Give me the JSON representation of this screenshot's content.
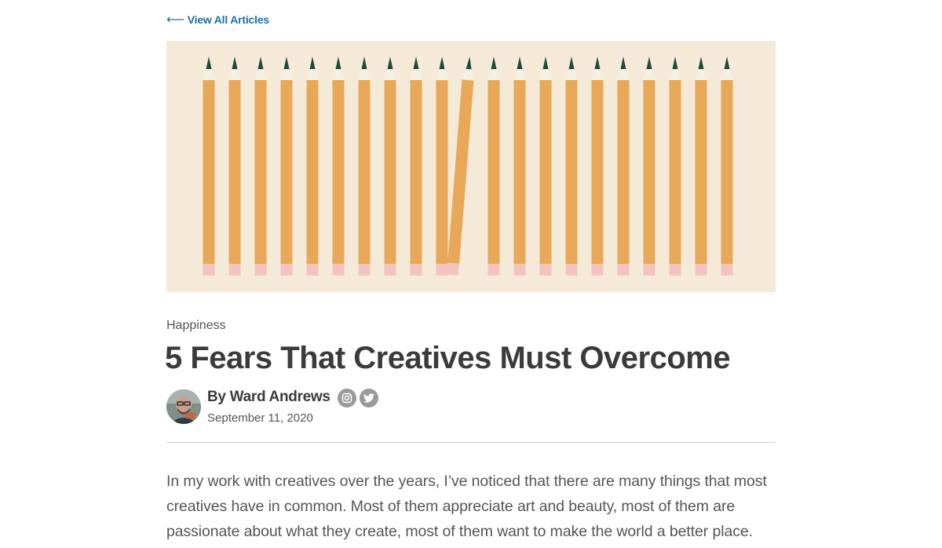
{
  "nav": {
    "back_arrow": "⟵",
    "back_label": "View All Articles"
  },
  "hero": {
    "illustration": "row of pencils with one tilted pencil",
    "colors": {
      "background": "#f5ead8",
      "pencil_body": "#e8a857",
      "pencil_wood": "#f3f0e6",
      "pencil_lead": "#1f4a3a",
      "eraser": "#f3c3c0"
    },
    "pencil_count": 21,
    "tilted_pencil_index": 10
  },
  "article": {
    "category": "Happiness",
    "title": "5 Fears That Creatives Must Overcome",
    "author": "By Ward Andrews",
    "date": "September 11, 2020",
    "social_icons": [
      "instagram-icon",
      "twitter-icon"
    ],
    "body": "In my work with creatives over the years, I’ve noticed that there are many things that most creatives have in common. Most of them appreciate art and beauty, most of them are passionate about what they create, most of them want to make the world a better place."
  },
  "colors": {
    "link": "#1a6faf",
    "title": "#3b3b3b",
    "text": "#555555",
    "divider": "#cfcfcf",
    "social_bg": "#9a9a9a"
  }
}
